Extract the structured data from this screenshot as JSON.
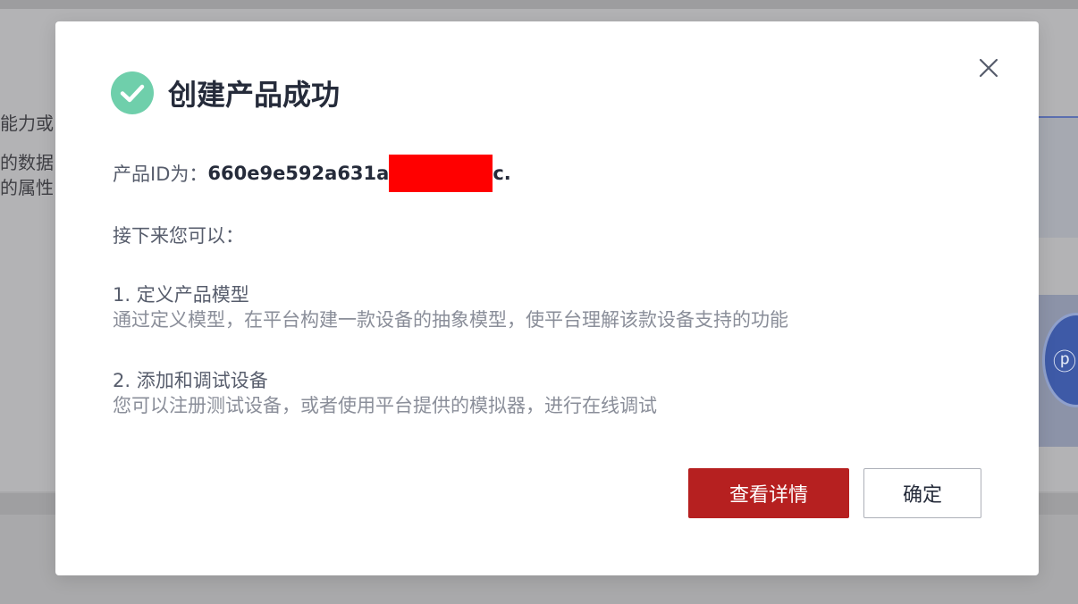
{
  "background": {
    "texts": [
      "能力或",
      "的数据",
      "的属性"
    ]
  },
  "dialog": {
    "title": "创建产品成功",
    "product_id_label": "产品ID为：",
    "product_id_prefix": "660e9e592a631a",
    "product_id_suffix": "c.",
    "next_label": "接下来您可以：",
    "steps": [
      {
        "title": "1. 定义产品模型",
        "description": "通过定义模型，在平台构建一款设备的抽象模型，使平台理解该款设备支持的功能"
      },
      {
        "title": "2. 添加和调试设备",
        "description": "您可以注册测试设备，或者使用平台提供的模拟器，进行在线调试"
      }
    ],
    "primary_button": "查看详情",
    "secondary_button": "确定",
    "close_icon": "close-icon",
    "success_icon": "check-circle-icon",
    "colors": {
      "success": "#6fcfab",
      "primary": "#b62020",
      "title": "#252b3a",
      "redaction": "#ff0000"
    }
  }
}
